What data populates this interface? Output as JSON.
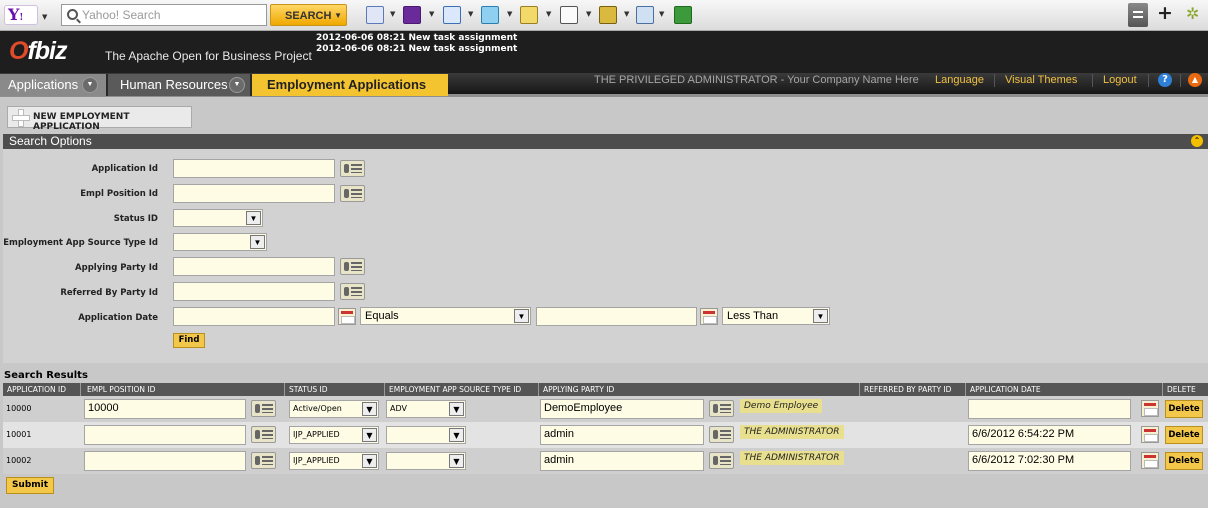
{
  "browser_toolbar": {
    "yahoo_logo": "Y!",
    "search_placeholder": "Yahoo! Search",
    "search_button": "SEARCH",
    "icons": [
      "bookmark-icon",
      "myyahoo-icon",
      "mail-icon",
      "news-icon",
      "notes-icon",
      "calendar-icon",
      "folder-icon",
      "chart-icon",
      "word-icon"
    ]
  },
  "header": {
    "logo": "Ofbiz",
    "tagline": "The Apache Open for Business Project",
    "messages": [
      "2012-06-06 08:21 New task assignment",
      "2012-06-06 08:21 New task assignment"
    ]
  },
  "nav": {
    "tabs": [
      {
        "label": "Applications"
      },
      {
        "label": "Human Resources"
      },
      {
        "label": "Employment Applications"
      }
    ],
    "user_info": "THE PRIVILEGED ADMINISTRATOR - Your Company Name Here",
    "links": [
      "Language",
      "Visual Themes",
      "Logout"
    ],
    "help": "?"
  },
  "actions": {
    "new_button": "NEW EMPLOYMENT APPLICATION"
  },
  "search_options": {
    "title": "Search Options",
    "fields": {
      "application_id": "Application Id",
      "empl_position_id": "Empl Position Id",
      "status_id": "Status ID",
      "source_type_id": "Employment App Source Type Id",
      "applying_party_id": "Applying Party Id",
      "referred_by_party_id": "Referred By Party Id",
      "application_date": "Application Date"
    },
    "date_op_1": "Equals",
    "date_op_2": "Less Than",
    "find_button": "Find"
  },
  "results": {
    "title": "Search Results",
    "columns": [
      "APPLICATION ID",
      "EMPL POSITION ID",
      "STATUS ID",
      "EMPLOYMENT APP SOURCE TYPE ID",
      "APPLYING PARTY ID",
      "REFERRED BY PARTY ID",
      "APPLICATION DATE",
      "DELETE"
    ],
    "rows": [
      {
        "id": "10000",
        "position": "10000",
        "status": "Active/Open",
        "source": "ADV",
        "party": "DemoEmployee",
        "party_name": "Demo Employee",
        "date": "",
        "delete": "Delete"
      },
      {
        "id": "10001",
        "position": "",
        "status": "IJP_APPLIED",
        "source": "",
        "party": "admin",
        "party_name": "THE ADMINISTRATOR",
        "date": "6/6/2012 6:54:22 PM",
        "delete": "Delete"
      },
      {
        "id": "10002",
        "position": "",
        "status": "IJP_APPLIED",
        "source": "",
        "party": "admin",
        "party_name": "THE ADMINISTRATOR",
        "date": "6/6/2012 7:02:30 PM",
        "delete": "Delete"
      }
    ],
    "submit_button": "Submit"
  },
  "colors": {
    "accent": "#f4c430",
    "header_bg": "#1e1e1e",
    "input_bg": "#fffce5"
  }
}
